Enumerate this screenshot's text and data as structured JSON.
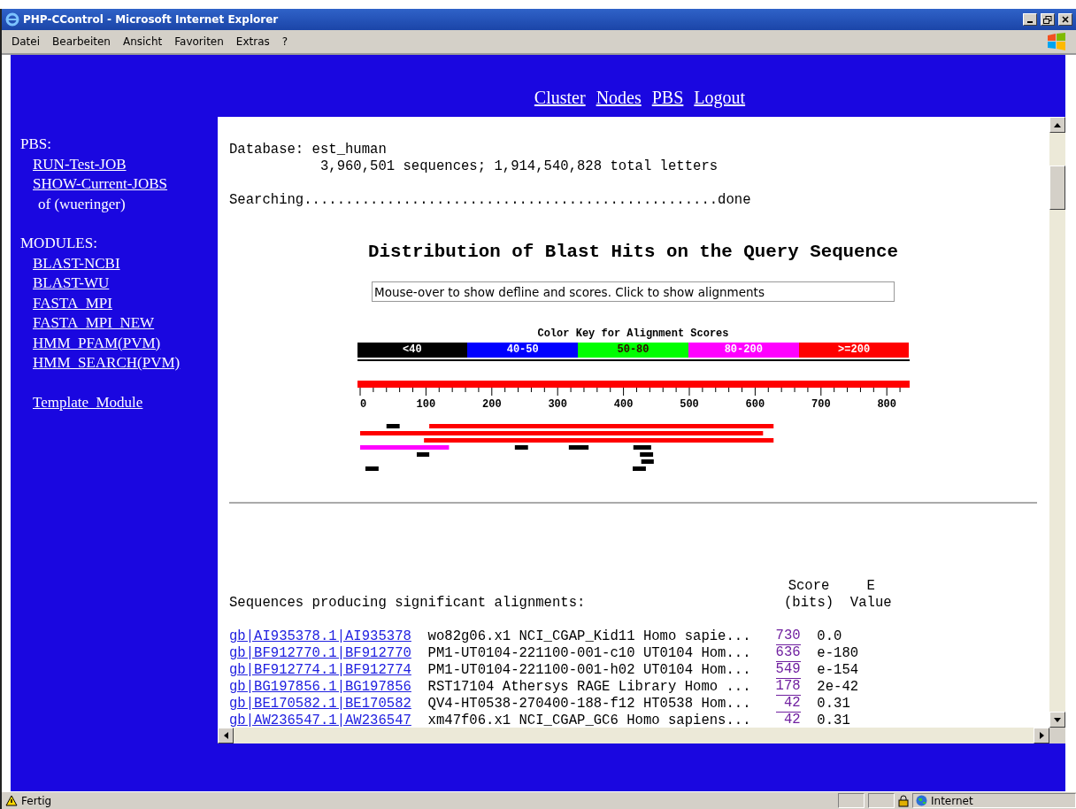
{
  "window": {
    "title": "PHP-CControl - Microsoft Internet Explorer"
  },
  "menu": [
    "Datei",
    "Bearbeiten",
    "Ansicht",
    "Favoriten",
    "Extras",
    "?"
  ],
  "nav": [
    "Cluster",
    "Nodes",
    "PBS",
    "Logout"
  ],
  "sidebar": {
    "sections": [
      {
        "heading": "PBS:",
        "items": [
          {
            "label": "RUN-Test-JOB",
            "kind": "link"
          },
          {
            "label": "SHOW-Current-JOBS",
            "kind": "link"
          },
          {
            "label": "of (wueringer)",
            "kind": "note"
          }
        ]
      },
      {
        "heading": "MODULES:",
        "items": [
          {
            "label": "BLAST-NCBI",
            "kind": "link"
          },
          {
            "label": "BLAST-WU",
            "kind": "link"
          },
          {
            "label": "FASTA_MPI",
            "kind": "link"
          },
          {
            "label": "FASTA_MPI_NEW",
            "kind": "link"
          },
          {
            "label": "HMM_PFAM(PVM)",
            "kind": "link"
          },
          {
            "label": "HMM_SEARCH(PVM)",
            "kind": "link"
          }
        ]
      },
      {
        "items": [
          {
            "label": "Template_Module",
            "kind": "link"
          }
        ]
      }
    ]
  },
  "output": {
    "database": "Database: est_human",
    "stats": "3,960,501 sequences; 1,914,540,828 total letters",
    "searching": "Searching..................................................done",
    "distribution": {
      "title": "Distribution of Blast Hits on the Query Sequence",
      "info_box": "Mouse-over to show defline and scores. Click to show alignments",
      "key_title": "Color Key for Alignment Scores",
      "key": [
        {
          "label": "<40",
          "color": "#000000"
        },
        {
          "label": "40-50",
          "color": "#0000ff"
        },
        {
          "label": "50-80",
          "color": "#00ff00"
        },
        {
          "label": "80-200",
          "color": "#ff00ff"
        },
        {
          "label": ">=200",
          "color": "#ff0000"
        }
      ],
      "axis_labels": [
        "0",
        "100",
        "200",
        "300",
        "400",
        "500",
        "600",
        "700",
        "800"
      ]
    },
    "alignments": {
      "caption": "Sequences producing significant alignments:",
      "score_header": [
        "Score",
        "(bits)"
      ],
      "evalue_header": [
        "E",
        "Value"
      ],
      "rows": [
        {
          "accession": "gb|AI935378.1|AI935378",
          "description": "wo82g06.x1 NCI_CGAP_Kid11 Homo sapie...",
          "score": "730",
          "evalue": "0.0"
        },
        {
          "accession": "gb|BF912770.1|BF912770",
          "description": "PM1-UT0104-221100-001-c10 UT0104 Hom...",
          "score": "636",
          "evalue": "e-180"
        },
        {
          "accession": "gb|BF912774.1|BF912774",
          "description": "PM1-UT0104-221100-001-h02 UT0104 Hom...",
          "score": "549",
          "evalue": "e-154"
        },
        {
          "accession": "gb|BG197856.1|BG197856",
          "description": "RST17104 Athersys RAGE Library Homo ...",
          "score": "178",
          "evalue": "2e-42"
        },
        {
          "accession": "gb|BE170582.1|BE170582",
          "description": "QV4-HT0538-270400-188-f12 HT0538 Hom...",
          "score": "42",
          "evalue": "0.31"
        },
        {
          "accession": "gb|AW236547.1|AW236547",
          "description": "xm47f06.x1 NCI_CGAP_GC6 Homo sapiens...",
          "score": "42",
          "evalue": "0.31"
        }
      ]
    }
  },
  "status_bar": {
    "text": "Fertig",
    "zone": "Internet"
  }
}
